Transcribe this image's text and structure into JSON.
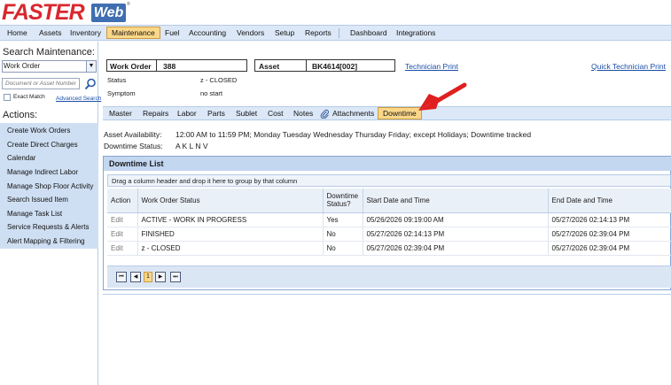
{
  "logo": {
    "brand": "FASTER",
    "web": "Web",
    "tm": "®"
  },
  "nav": {
    "items": [
      "Home",
      "Assets",
      "Inventory",
      "Maintenance",
      "Fuel",
      "Accounting",
      "Vendors",
      "Setup",
      "Reports",
      "Dashboard",
      "Integrations"
    ],
    "active": "Maintenance"
  },
  "sidebar": {
    "search_title": "Search Maintenance:",
    "select_value": "Work Order",
    "search_placeholder": "Document or Asset Number",
    "exact_match": "Exact Match",
    "advanced_search": "Advanced Search",
    "actions_title": "Actions:",
    "actions": [
      "Create Work Orders",
      "Create Direct Charges",
      "Calendar",
      "Manage Indirect Labor",
      "Manage Shop Floor Activity",
      "Search Issued Item",
      "Manage Task List",
      "Service Requests & Alerts",
      "Alert Mapping & Filtering"
    ]
  },
  "workorder": {
    "wo_label": "Work Order",
    "wo_number": "388",
    "asset_label": "Asset",
    "asset_number": "BK4614[002]",
    "technician_print": "Technician Print",
    "quick_technician_print": "Quick Technician Print",
    "status_label": "Status",
    "status_value": "z - CLOSED",
    "symptom_label": "Symptom",
    "symptom_value": "no start"
  },
  "tabs": {
    "items": [
      "Master",
      "Repairs",
      "Labor",
      "Parts",
      "Sublet",
      "Cost",
      "Notes",
      "Attachments",
      "Downtime"
    ],
    "active": "Downtime"
  },
  "availability": {
    "label": "Asset Availability:",
    "value": "12:00 AM to 11:59 PM; Monday Tuesday Wednesday Thursday Friday; except Holidays; Downtime tracked",
    "downtime_status_label": "Downtime Status:",
    "downtime_status_value": "A K L N V"
  },
  "downtime_list": {
    "title": "Downtime List",
    "group_hint": "Drag a column header and drop it here to group by that column",
    "columns": [
      "Action",
      "Work Order Status",
      "Downtime Status?",
      "Start Date and Time",
      "End Date and Time"
    ],
    "rows": [
      {
        "action": "Edit",
        "status": "ACTIVE - WORK IN PROGRESS",
        "downtime": "Yes",
        "start": "05/26/2026 09:19:00 AM",
        "end": "05/27/2026 02:14:13 PM"
      },
      {
        "action": "Edit",
        "status": "FINISHED",
        "downtime": "No",
        "start": "05/27/2026 02:14:13 PM",
        "end": "05/27/2026 02:39:04 PM"
      },
      {
        "action": "Edit",
        "status": "z - CLOSED",
        "downtime": "No",
        "start": "05/27/2026 02:39:04 PM",
        "end": "05/27/2026 02:39:04 PM"
      }
    ],
    "pager": {
      "first": "⏮",
      "prev": "◀",
      "page": "1",
      "next": "▶",
      "last": "⏭"
    }
  },
  "colors": {
    "accent_red": "#d9272e",
    "nav_bg": "#dce8f7",
    "active_tab": "#fbd78a",
    "link": "#1a4fa8"
  }
}
